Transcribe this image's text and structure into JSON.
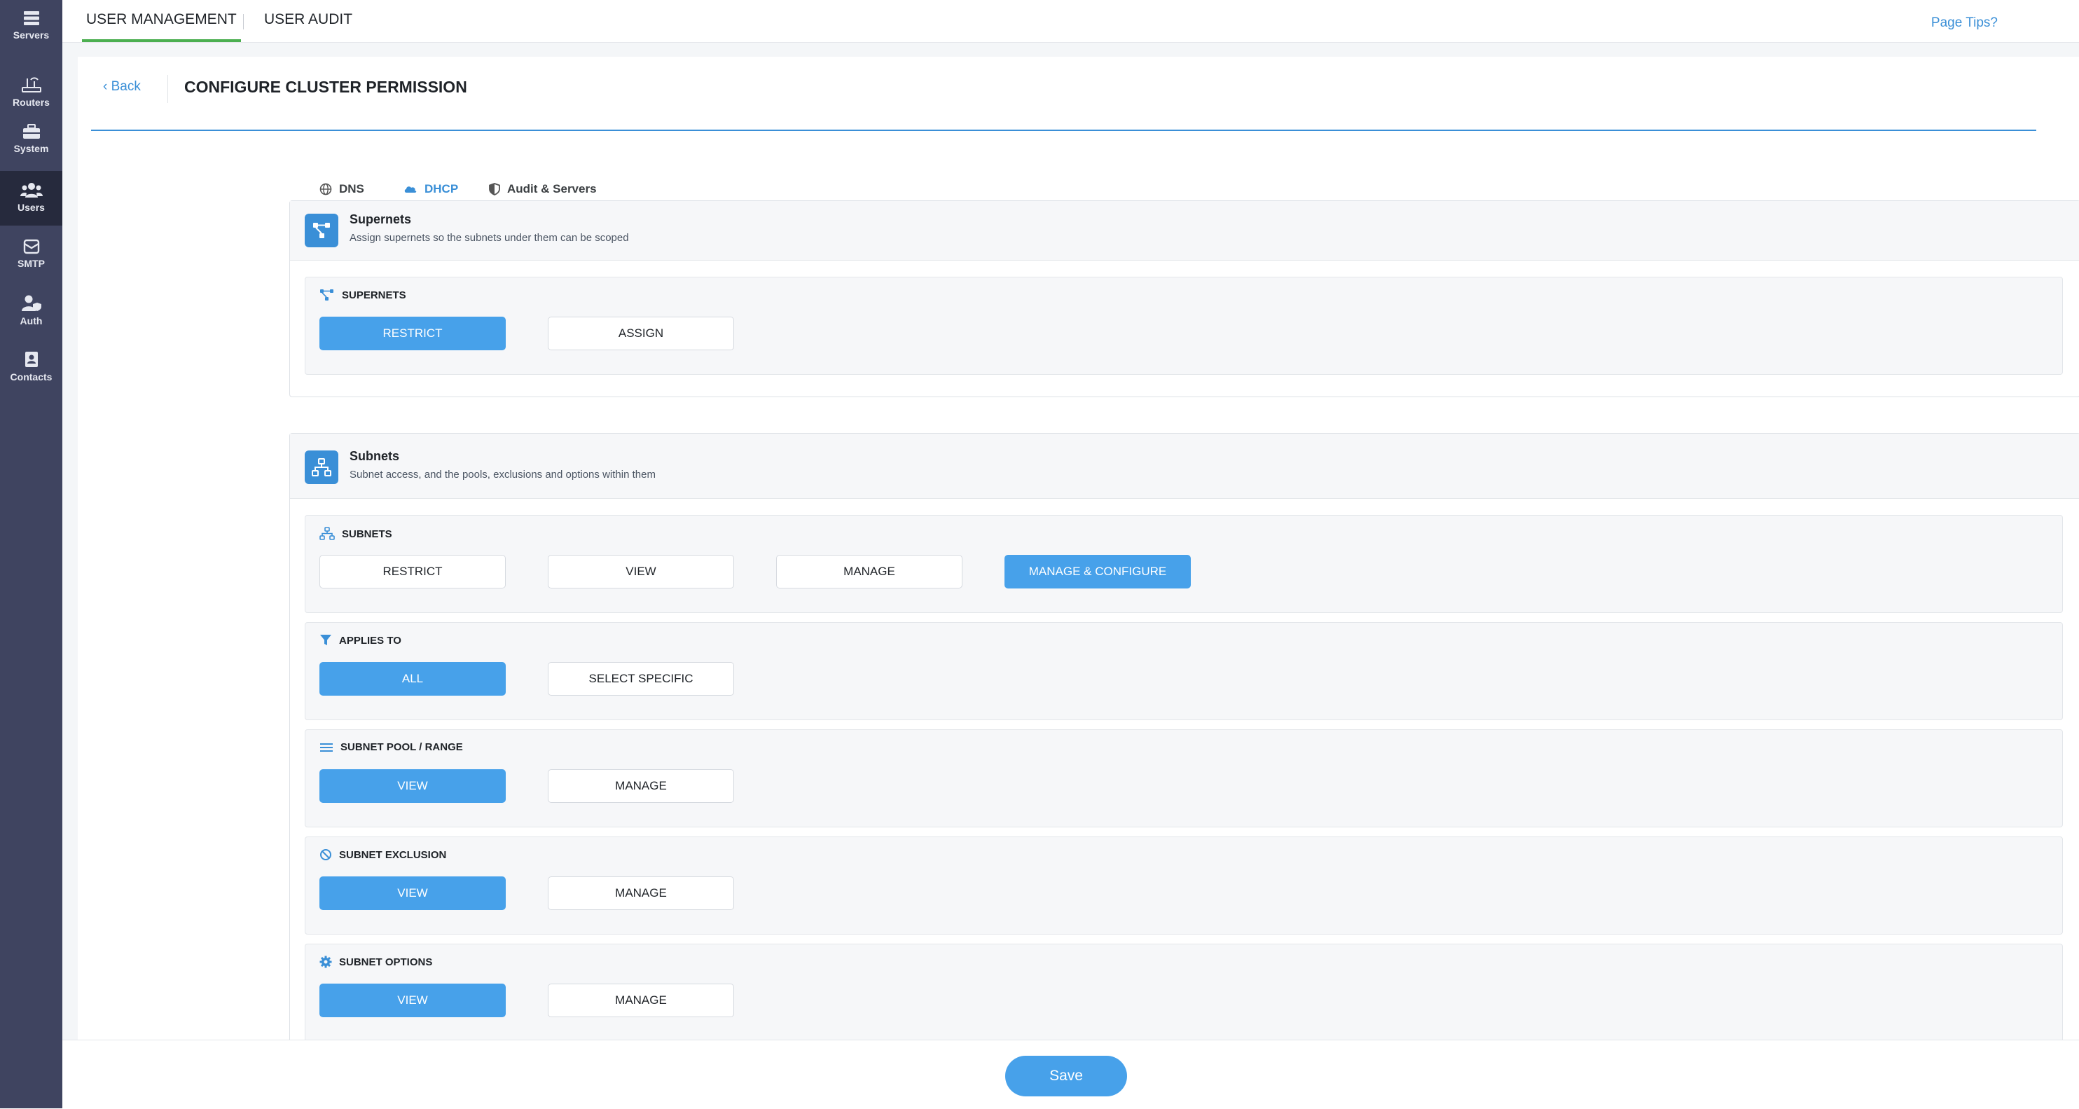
{
  "sidebar": {
    "items": [
      {
        "label": "Servers",
        "icon": "server-icon"
      },
      {
        "label": "Routers",
        "icon": "router-icon"
      },
      {
        "label": "System",
        "icon": "toolbox-icon"
      },
      {
        "label": "Users",
        "icon": "users-icon",
        "active": true
      },
      {
        "label": "SMTP",
        "icon": "mail-icon"
      },
      {
        "label": "Auth",
        "icon": "user-shield-icon"
      },
      {
        "label": "Contacts",
        "icon": "contact-book-icon"
      }
    ]
  },
  "topbar": {
    "tabs": [
      {
        "label": "USER MANAGEMENT",
        "active": true
      },
      {
        "label": "USER AUDIT",
        "active": false
      }
    ],
    "page_tips": "Page Tips?"
  },
  "page": {
    "back_label": "Back",
    "title": "CONFIGURE CLUSTER PERMISSION"
  },
  "tabs": [
    {
      "label": "DNS",
      "icon": "globe-icon",
      "active": false
    },
    {
      "label": "DHCP",
      "icon": "cloud-icon",
      "active": true
    },
    {
      "label": "Audit & Servers",
      "icon": "shield-icon",
      "active": false
    }
  ],
  "supernets_panel": {
    "title": "Supernets",
    "description": "Assign supernets so the subnets under them can be scoped",
    "groups": [
      {
        "label": "SUPERNETS",
        "icon": "supernet-icon",
        "options": [
          "RESTRICT",
          "ASSIGN"
        ],
        "selected": "RESTRICT"
      }
    ]
  },
  "subnets_panel": {
    "title": "Subnets",
    "description": "Subnet access, and the pools, exclusions and options within them",
    "groups": [
      {
        "label": "SUBNETS",
        "icon": "subnet-icon",
        "options": [
          "RESTRICT",
          "VIEW",
          "MANAGE",
          "MANAGE & CONFIGURE"
        ],
        "selected": "MANAGE & CONFIGURE"
      },
      {
        "label": "APPLIES TO",
        "icon": "filter-icon",
        "options": [
          "ALL",
          "SELECT SPECIFIC"
        ],
        "selected": "ALL"
      },
      {
        "label": "SUBNET POOL / RANGE",
        "icon": "list-icon",
        "options": [
          "VIEW",
          "MANAGE"
        ],
        "selected": "VIEW"
      },
      {
        "label": "SUBNET EXCLUSION",
        "icon": "ban-icon",
        "options": [
          "VIEW",
          "MANAGE"
        ],
        "selected": "VIEW"
      },
      {
        "label": "SUBNET OPTIONS",
        "icon": "gear-icon",
        "options": [
          "VIEW",
          "MANAGE"
        ],
        "selected": "VIEW"
      }
    ]
  },
  "footer": {
    "save_label": "Save"
  },
  "colors": {
    "accent": "#47a1ea",
    "link": "#3a8fd7",
    "sidebar": "#3f4460",
    "active_tab_underline": "#4caf50"
  }
}
